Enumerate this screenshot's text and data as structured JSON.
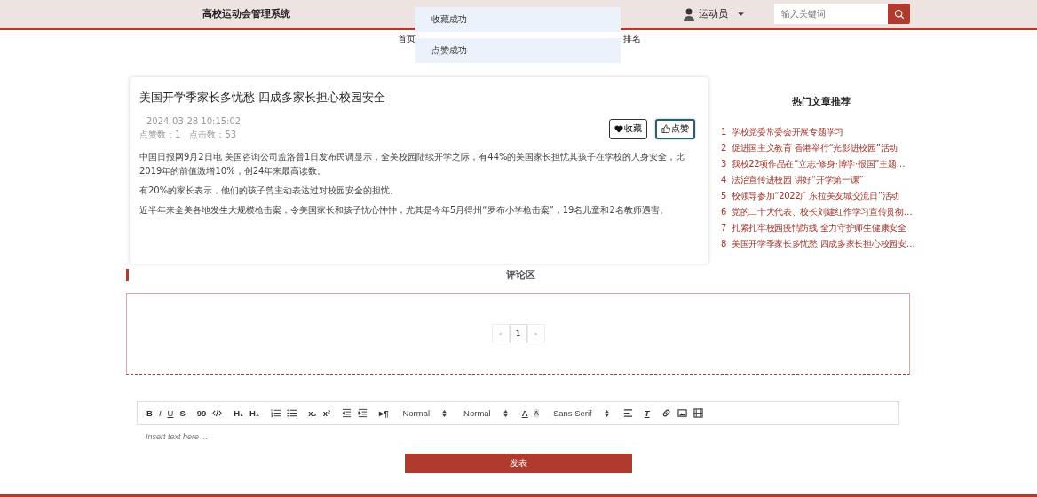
{
  "header": {
    "title": "高校运动会管理系统",
    "user": "运动员",
    "search": {
      "placeholder": "输入关键词"
    }
  },
  "nav": [
    {
      "label": "首页",
      "selected": false
    },
    {
      "label": "排名",
      "selected": false
    }
  ],
  "toasts": [
    {
      "text": "收藏成功"
    },
    {
      "text": "点赞成功"
    }
  ],
  "article": {
    "title": "美国开学季家长多忧愁 四成多家长担心校园安全",
    "date": "2024-03-28 10:15:02",
    "likes_label": "点赞数：",
    "likes": "1",
    "clicks_label": "点击数：",
    "clicks": "53",
    "buttons": [
      {
        "kind": "favorite",
        "label": "收藏",
        "selected": false
      },
      {
        "kind": "like",
        "label": "点赞",
        "selected": true
      }
    ],
    "paragraphs": [
      "中国日报网9月2日电 美国咨询公司盖洛普1日发布民调显示，全美校园陆续开学之际，有44%的美国家长担忧其孩子在学校的人身安全，比2019年的前值激增10%，创24年来最高读数。",
      "有20%的家长表示，他们的孩子曾主动表达过对校园安全的担忧。",
      "近半年来全美各地发生大规模枪击案，令美国家长和孩子忧心忡忡，尤其是今年5月得州“罗布小学枪击案”，19名儿童和2名教师遇害。"
    ]
  },
  "hot": {
    "title": "热门文章推荐",
    "items": [
      {
        "rank": "1",
        "title": "学校党委常委会开展专题学习"
      },
      {
        "rank": "2",
        "title": "促进国主义教育 香港举行“光影进校园”活动"
      },
      {
        "rank": "3",
        "title": "我校22项作品在“立志·修身·博学·报国”主题…"
      },
      {
        "rank": "4",
        "title": "法治宣传进校园 讲好“开学第一课”"
      },
      {
        "rank": "5",
        "title": "校领导参加“2022广东拉美友城交流日”活动"
      },
      {
        "rank": "6",
        "title": "党的二十大代表、校长刘建红作学习宣传贯彻…"
      },
      {
        "rank": "7",
        "title": "扎紧扎牢校园疫情防线 全力守护师生健康安全"
      },
      {
        "rank": "8",
        "title": "美国开学季家长多忧愁 四成多家长担心校园安…"
      }
    ]
  },
  "comments": {
    "title": "评论区",
    "pagination": {
      "prev": "‹",
      "pages": [
        {
          "label": "1",
          "selected": true
        }
      ],
      "next": "›"
    }
  },
  "editor": {
    "toolbar": [
      [
        {
          "kind": "bold",
          "label": "B"
        },
        {
          "kind": "italic",
          "label": "I"
        },
        {
          "kind": "underline",
          "label": "U"
        },
        {
          "kind": "strike",
          "label": "S"
        }
      ],
      [
        {
          "kind": "quote",
          "label": "99"
        },
        {
          "kind": "code"
        }
      ],
      [
        {
          "kind": "header",
          "label": "H₁"
        },
        {
          "kind": "header",
          "label": "H₂"
        }
      ],
      [
        {
          "kind": "ordered-list"
        },
        {
          "kind": "bullet-list"
        }
      ],
      [
        {
          "kind": "script",
          "label": "x₂"
        },
        {
          "kind": "script",
          "label": "x²"
        }
      ],
      [
        {
          "kind": "outdent"
        },
        {
          "kind": "indent"
        }
      ],
      [
        {
          "kind": "direction",
          "label": "▸¶"
        }
      ],
      [
        {
          "kind": "select",
          "label": "Normal"
        }
      ],
      [
        {
          "kind": "select",
          "label": "Normal"
        }
      ],
      [
        {
          "kind": "color",
          "label": "A"
        },
        {
          "kind": "background",
          "label": "A"
        }
      ],
      [
        {
          "kind": "select",
          "label": "Sans Serif"
        }
      ],
      [
        {
          "kind": "align"
        }
      ],
      [
        {
          "kind": "clean",
          "label": "T"
        }
      ],
      [
        {
          "kind": "link"
        },
        {
          "kind": "image"
        },
        {
          "kind": "video"
        }
      ]
    ],
    "placeholder": "Insert text here ...",
    "submit": "发表"
  }
}
